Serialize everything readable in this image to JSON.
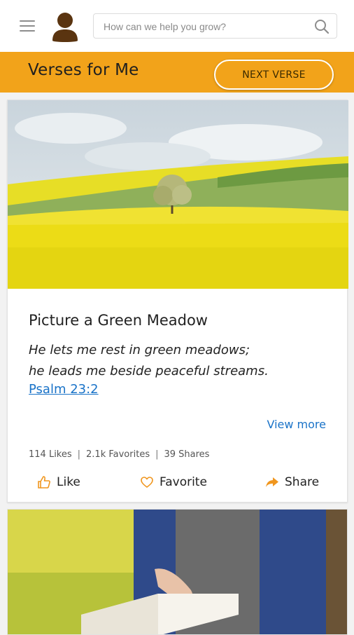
{
  "header": {
    "search_placeholder": "How can we help you grow?"
  },
  "banner": {
    "title": "Verses for Me",
    "next_button": "NEXT VERSE"
  },
  "card": {
    "title": "Picture a Green Meadow",
    "verse_line1": "He lets me rest in green meadows;",
    "verse_line2": "he leads me beside peaceful streams.",
    "reference": "Psalm 23:2",
    "view_more": "View more",
    "stats": {
      "likes": "114 Likes",
      "favorites": "2.1k Favorites",
      "shares": "39 Shares",
      "separator": "|"
    },
    "actions": {
      "like": "Like",
      "favorite": "Favorite",
      "share": "Share"
    }
  },
  "colors": {
    "accent": "#f2a31a",
    "link": "#1a73c8",
    "icon_orange": "#f0961e"
  },
  "icons": {
    "menu": "hamburger-icon",
    "avatar": "user-avatar-icon",
    "search": "search-icon",
    "like": "thumbs-up-icon",
    "favorite": "heart-icon",
    "share": "share-arrow-icon"
  }
}
